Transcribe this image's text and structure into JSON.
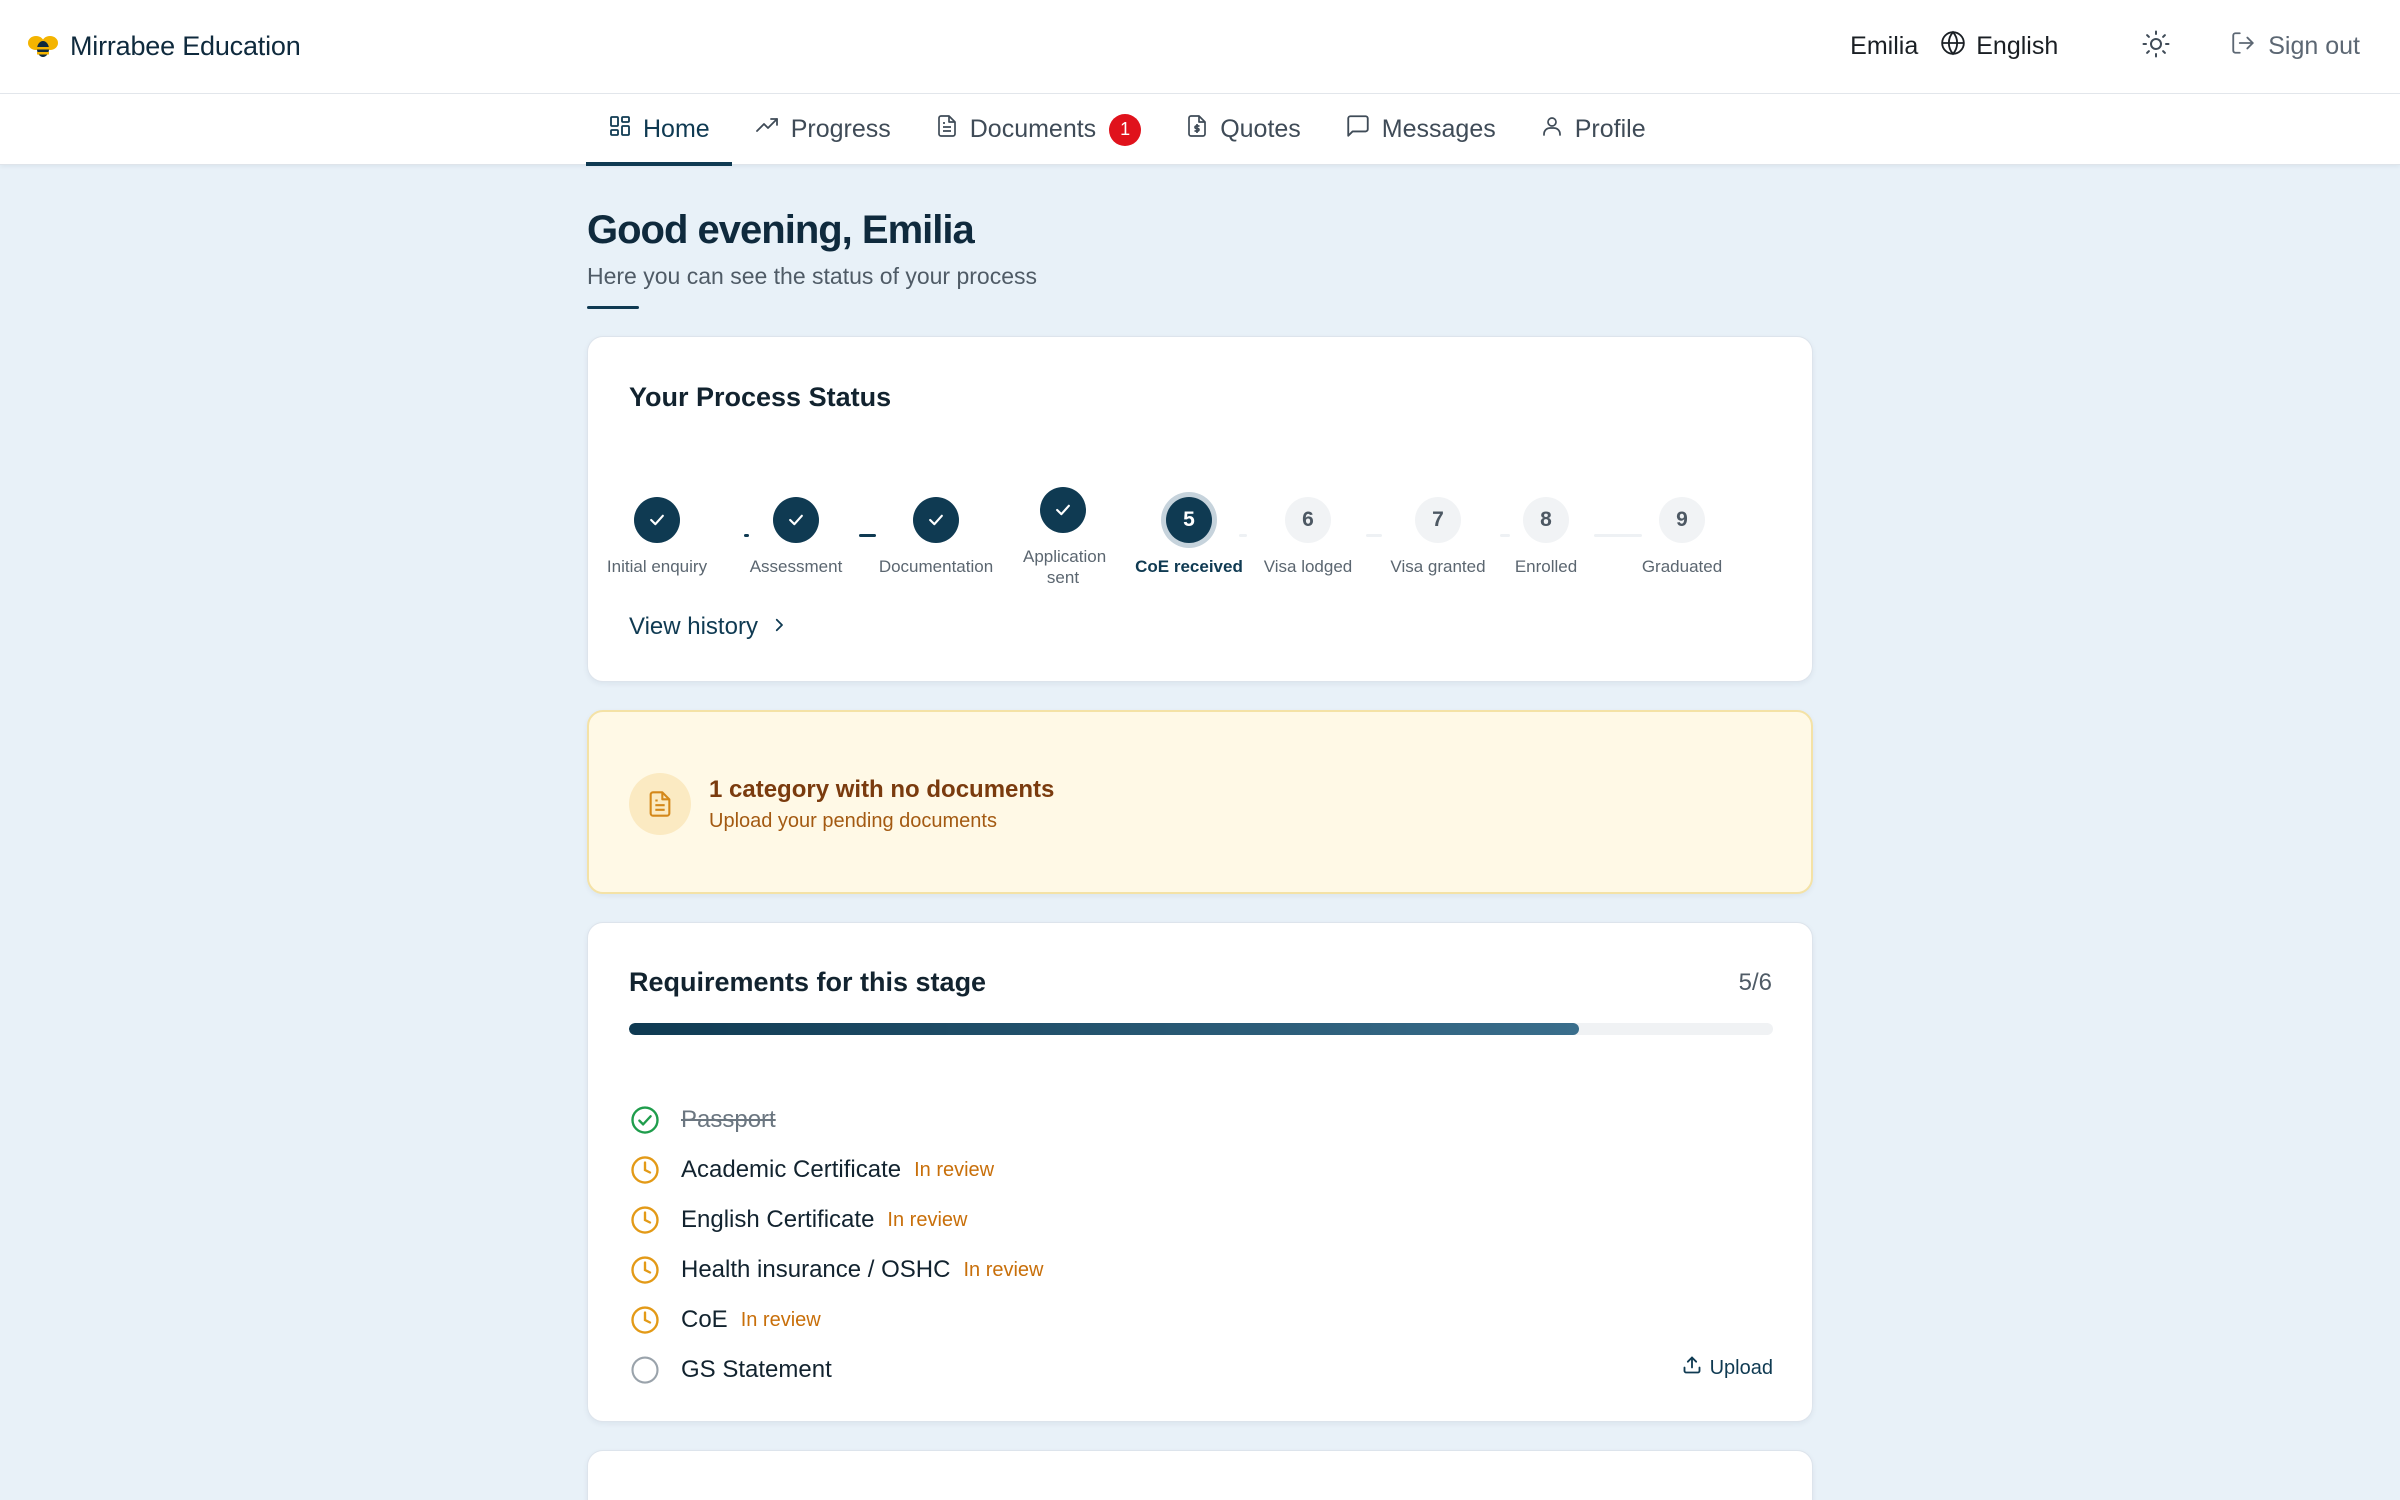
{
  "app": {
    "brand_name": "Mirrabee Education",
    "brand_icon": "bee-logo-icon",
    "user_name": "Emilia",
    "language": "English",
    "sign_out_label": "Sign out"
  },
  "nav": {
    "items": [
      {
        "label": "Home",
        "icon": "dashboard-icon",
        "active": true
      },
      {
        "label": "Progress",
        "icon": "trending-up-icon"
      },
      {
        "label": "Documents",
        "icon": "document-icon",
        "badge": "1"
      },
      {
        "label": "Quotes",
        "icon": "dollar-document-icon"
      },
      {
        "label": "Messages",
        "icon": "chat-icon"
      },
      {
        "label": "Profile",
        "icon": "user-icon"
      }
    ]
  },
  "greeting": {
    "title": "Good evening, Emilia",
    "subtitle": "Here you can see the status of your process"
  },
  "process_status": {
    "title": "Your Process Status",
    "view_history_label": "View history",
    "steps": [
      {
        "number": "1",
        "label": "Initial enquiry",
        "state": "done"
      },
      {
        "number": "2",
        "label": "Assessment",
        "state": "done"
      },
      {
        "number": "3",
        "label": "Documentation",
        "state": "done"
      },
      {
        "number": "4",
        "label": "Application sent",
        "state": "done"
      },
      {
        "number": "5",
        "label": "CoE received",
        "state": "current"
      },
      {
        "number": "6",
        "label": "Visa lodged",
        "state": "todo"
      },
      {
        "number": "7",
        "label": "Visa granted",
        "state": "todo"
      },
      {
        "number": "8",
        "label": "Enrolled",
        "state": "todo"
      },
      {
        "number": "9",
        "label": "Graduated",
        "state": "todo"
      }
    ]
  },
  "alert": {
    "title": "1 category with no documents",
    "subtitle": "Upload your pending documents",
    "icon": "document-icon"
  },
  "requirements": {
    "title": "Requirements for this stage",
    "count": "5/6",
    "progress": 0.83,
    "items": [
      {
        "name": "Passport",
        "state": "done",
        "status": ""
      },
      {
        "name": "Academic Certificate",
        "state": "review",
        "status": "In review"
      },
      {
        "name": "English Certificate",
        "state": "review",
        "status": "In review"
      },
      {
        "name": "Health insurance / OSHC",
        "state": "review",
        "status": "In review"
      },
      {
        "name": "CoE",
        "state": "review",
        "status": "In review"
      },
      {
        "name": "GS Statement",
        "state": "pending",
        "status": ""
      }
    ],
    "upload_label": "Upload"
  },
  "colors": {
    "primary": "#0f3a52",
    "background": "#e8f1f8",
    "badge": "#e0121c",
    "warning_text": "#c86f0a",
    "success": "#1f9d4c"
  }
}
